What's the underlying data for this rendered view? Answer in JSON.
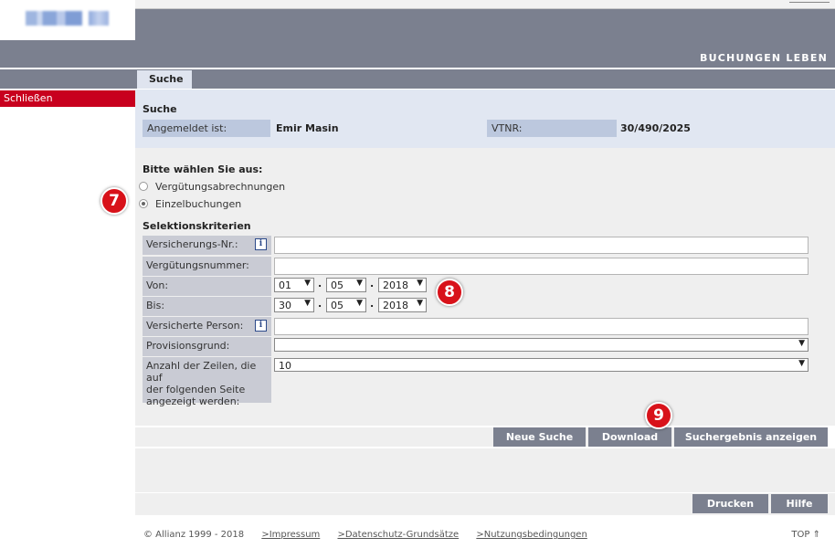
{
  "header": {
    "title": "BUCHUNGEN LEBEN"
  },
  "tabs": [
    {
      "label": "Suche"
    }
  ],
  "nav": {
    "close_label": "Schließen"
  },
  "info": {
    "title": "Suche",
    "logged_in_label": "Angemeldet ist:",
    "logged_in_value": "Emir Masin",
    "vtnr_label": "VTNR:",
    "vtnr_value": "30/490/2025"
  },
  "form": {
    "choose_title": "Bitte wählen Sie aus:",
    "radio_options": [
      {
        "label": "Vergütungsabrechnungen",
        "selected": false
      },
      {
        "label": "Einzelbuchungen",
        "selected": true
      }
    ],
    "criteria_title": "Selektionskriterien",
    "fields": {
      "versicherungs_nr": {
        "label": "Versicherungs-Nr.:",
        "value": ""
      },
      "verguetungsnummer": {
        "label": "Vergütungsnummer:",
        "value": ""
      },
      "von": {
        "label": "Von:",
        "day": "01",
        "month": "05",
        "year": "2018"
      },
      "bis": {
        "label": "Bis:",
        "day": "30",
        "month": "05",
        "year": "2018"
      },
      "versicherte_person": {
        "label": "Versicherte Person:",
        "value": ""
      },
      "provisionsgrund": {
        "label": "Provisionsgrund:",
        "value": ""
      },
      "anzahl_zeilen": {
        "label_line1": "Anzahl der Zeilen, die auf",
        "label_line2": "der folgenden Seite",
        "label_line3": "angezeigt werden:",
        "value": "10"
      }
    },
    "info_icon_glyph": "i"
  },
  "actions": {
    "new_search": "Neue Suche",
    "download": "Download",
    "show_results": "Suchergebnis anzeigen",
    "print": "Drucken",
    "help": "Hilfe"
  },
  "footer": {
    "copyright": "© Allianz 1999 - 2018",
    "links": [
      ">Impressum",
      ">Datenschutz-Grundsätze",
      ">Nutzungsbedingungen"
    ],
    "top": "TOP ⇑"
  },
  "callouts": [
    "7",
    "8",
    "9"
  ],
  "colors": {
    "header": "#7b808f",
    "close_red": "#c8001e",
    "badge_red": "#d8121a"
  }
}
